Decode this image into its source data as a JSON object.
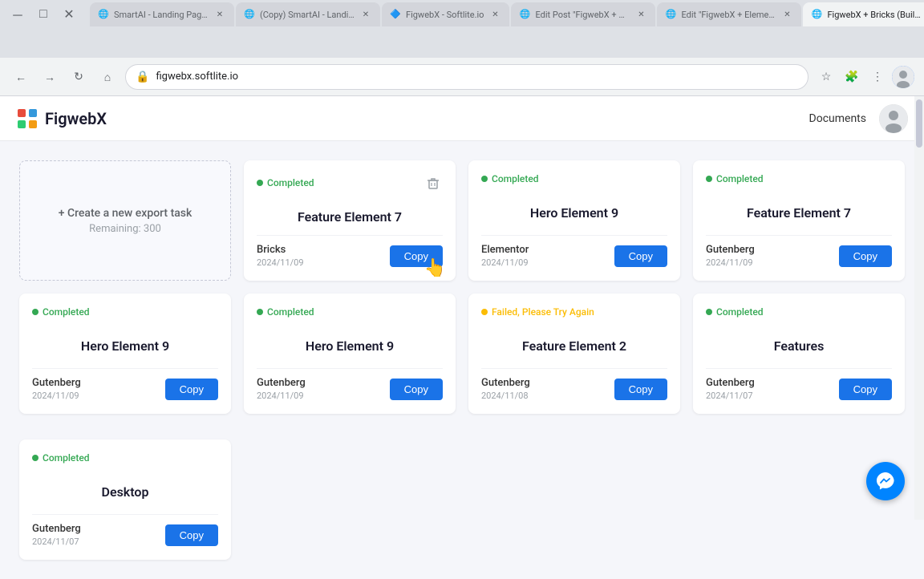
{
  "browser": {
    "tabs": [
      {
        "id": "tab1",
        "label": "SmartAI - Landing Page -...",
        "active": false,
        "favicon": "🌐"
      },
      {
        "id": "tab2",
        "label": "(Copy) SmartAI - Landing ...",
        "active": false,
        "favicon": "🌐"
      },
      {
        "id": "tab3",
        "label": "FigwebX - Softlite.io",
        "active": false,
        "favicon": "🔷"
      },
      {
        "id": "tab4",
        "label": "Edit Post \"FigwebX + Gute...",
        "active": false,
        "favicon": "🌐"
      },
      {
        "id": "tab5",
        "label": "Edit \"FigwebX + Elemento...",
        "active": false,
        "favicon": "🌐"
      },
      {
        "id": "tab6",
        "label": "FigwebX + Bricks (Builder)",
        "active": true,
        "favicon": "🌐"
      }
    ],
    "address": "figwebx.softlite.io",
    "controls": {
      "back": "←",
      "forward": "→",
      "refresh": "↻",
      "home": "⌂"
    }
  },
  "app": {
    "logo_text": "FigwebX",
    "nav": {
      "documents_label": "Documents"
    }
  },
  "create_card": {
    "label": "+ Create a new export task",
    "remaining_label": "Remaining: 300"
  },
  "cards": [
    {
      "id": "card1",
      "status": "Completed",
      "status_type": "completed",
      "title": "Feature Element 7",
      "meta_name": "Bricks",
      "meta_date": "2024/11/09",
      "has_delete": true,
      "copy_label": "Copy",
      "cursor_active": true
    },
    {
      "id": "card2",
      "status": "Completed",
      "status_type": "completed",
      "title": "Hero Element 9",
      "meta_name": "Elementor",
      "meta_date": "2024/11/09",
      "has_delete": false,
      "copy_label": "Copy",
      "cursor_active": false
    },
    {
      "id": "card3",
      "status": "Completed",
      "status_type": "completed",
      "title": "Feature Element 7",
      "meta_name": "Gutenberg",
      "meta_date": "2024/11/09",
      "has_delete": false,
      "copy_label": "Copy",
      "cursor_active": false
    },
    {
      "id": "card4",
      "status": "Completed",
      "status_type": "completed",
      "title": "Hero Element 9",
      "meta_name": "Gutenberg",
      "meta_date": "2024/11/09",
      "has_delete": false,
      "copy_label": "Copy",
      "cursor_active": false
    },
    {
      "id": "card5",
      "status": "Completed",
      "status_type": "completed",
      "title": "Hero Element 9",
      "meta_name": "Gutenberg",
      "meta_date": "2024/11/09",
      "has_delete": false,
      "copy_label": "Copy",
      "cursor_active": false
    },
    {
      "id": "card6",
      "status": "Failed, Please Try Again",
      "status_type": "failed",
      "title": "Feature Element 2",
      "meta_name": "Gutenberg",
      "meta_date": "2024/11/08",
      "has_delete": false,
      "copy_label": "Copy",
      "cursor_active": false
    },
    {
      "id": "card7",
      "status": "Completed",
      "status_type": "completed",
      "title": "Features",
      "meta_name": "Gutenberg",
      "meta_date": "2024/11/07",
      "has_delete": false,
      "copy_label": "Copy",
      "cursor_active": false
    },
    {
      "id": "card8",
      "status": "Completed",
      "status_type": "completed",
      "title": "Desktop",
      "meta_name": "Gutenberg",
      "meta_date": "2024/11/07",
      "has_delete": false,
      "copy_label": "Copy",
      "cursor_active": false
    }
  ],
  "colors": {
    "completed": "#34a853",
    "failed": "#fbbc04",
    "copy_btn": "#1a73e8",
    "messenger": "#0084ff"
  }
}
